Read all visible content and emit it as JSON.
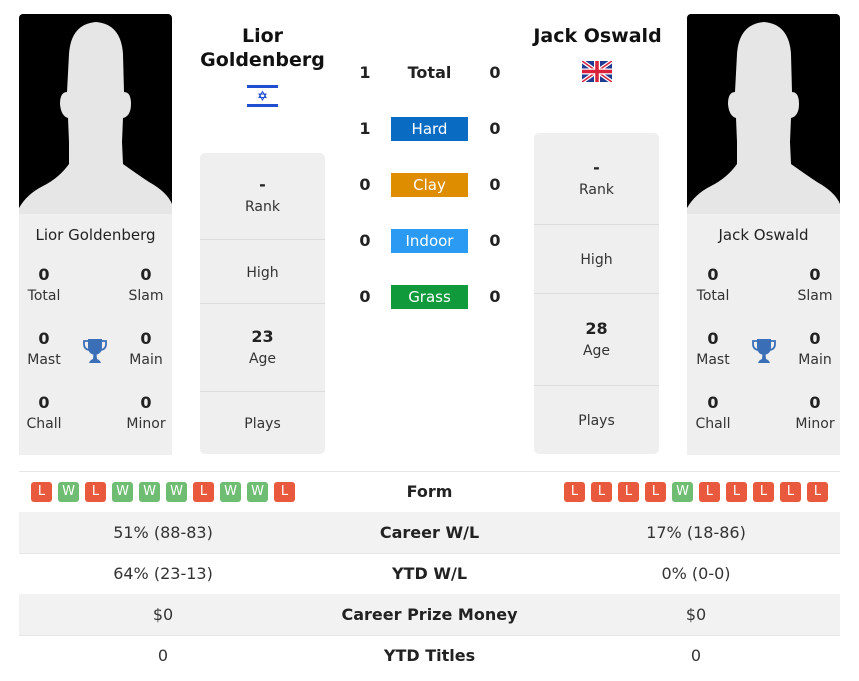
{
  "player1": {
    "name": "Lior Goldenberg",
    "name_line1": "Lior",
    "name_line2": "Goldenberg",
    "country": "Israel",
    "flag_icon": "israel-flag-icon",
    "photo_icon": "player-silhouette-icon",
    "titles": {
      "total": {
        "value": "0",
        "label": "Total"
      },
      "slam": {
        "value": "0",
        "label": "Slam"
      },
      "mast": {
        "value": "0",
        "label": "Mast"
      },
      "main": {
        "value": "0",
        "label": "Main"
      },
      "chall": {
        "value": "0",
        "label": "Chall"
      },
      "minor": {
        "value": "0",
        "label": "Minor"
      }
    },
    "info": {
      "rank": {
        "value": "-",
        "label": "Rank"
      },
      "high": {
        "value": "",
        "label": "High"
      },
      "age": {
        "value": "23",
        "label": "Age"
      },
      "plays": {
        "value": "",
        "label": "Plays"
      }
    },
    "form": [
      "L",
      "W",
      "L",
      "W",
      "W",
      "W",
      "L",
      "W",
      "W",
      "L"
    ],
    "career_wl": "51% (88-83)",
    "ytd_wl": "64% (23-13)",
    "prize_money": "$0",
    "ytd_titles": "0"
  },
  "player2": {
    "name": "Jack Oswald",
    "country": "Great Britain",
    "flag_icon": "uk-flag-icon",
    "photo_icon": "player-silhouette-icon",
    "titles": {
      "total": {
        "value": "0",
        "label": "Total"
      },
      "slam": {
        "value": "0",
        "label": "Slam"
      },
      "mast": {
        "value": "0",
        "label": "Mast"
      },
      "main": {
        "value": "0",
        "label": "Main"
      },
      "chall": {
        "value": "0",
        "label": "Chall"
      },
      "minor": {
        "value": "0",
        "label": "Minor"
      }
    },
    "info": {
      "rank": {
        "value": "-",
        "label": "Rank"
      },
      "high": {
        "value": "",
        "label": "High"
      },
      "age": {
        "value": "28",
        "label": "Age"
      },
      "plays": {
        "value": "",
        "label": "Plays"
      }
    },
    "form": [
      "L",
      "L",
      "L",
      "L",
      "W",
      "L",
      "L",
      "L",
      "L",
      "L"
    ],
    "career_wl": "17% (18-86)",
    "ytd_wl": "0% (0-0)",
    "prize_money": "$0",
    "ytd_titles": "0"
  },
  "h2h": [
    {
      "label": "Total",
      "p1": "1",
      "p2": "0",
      "color": ""
    },
    {
      "label": "Hard",
      "p1": "1",
      "p2": "0",
      "color": "#0a6bc2"
    },
    {
      "label": "Clay",
      "p1": "0",
      "p2": "0",
      "color": "#de8c00"
    },
    {
      "label": "Indoor",
      "p1": "0",
      "p2": "0",
      "color": "#2b9af3"
    },
    {
      "label": "Grass",
      "p1": "0",
      "p2": "0",
      "color": "#109a3c"
    }
  ],
  "table": {
    "form_label": "Form",
    "career_wl_label": "Career W/L",
    "ytd_wl_label": "YTD W/L",
    "prize_label": "Career Prize Money",
    "ytd_titles_label": "YTD Titles"
  },
  "colors": {
    "win": "#6fbd72",
    "loss": "#e8593e",
    "trophy": "#3a6fb8"
  }
}
